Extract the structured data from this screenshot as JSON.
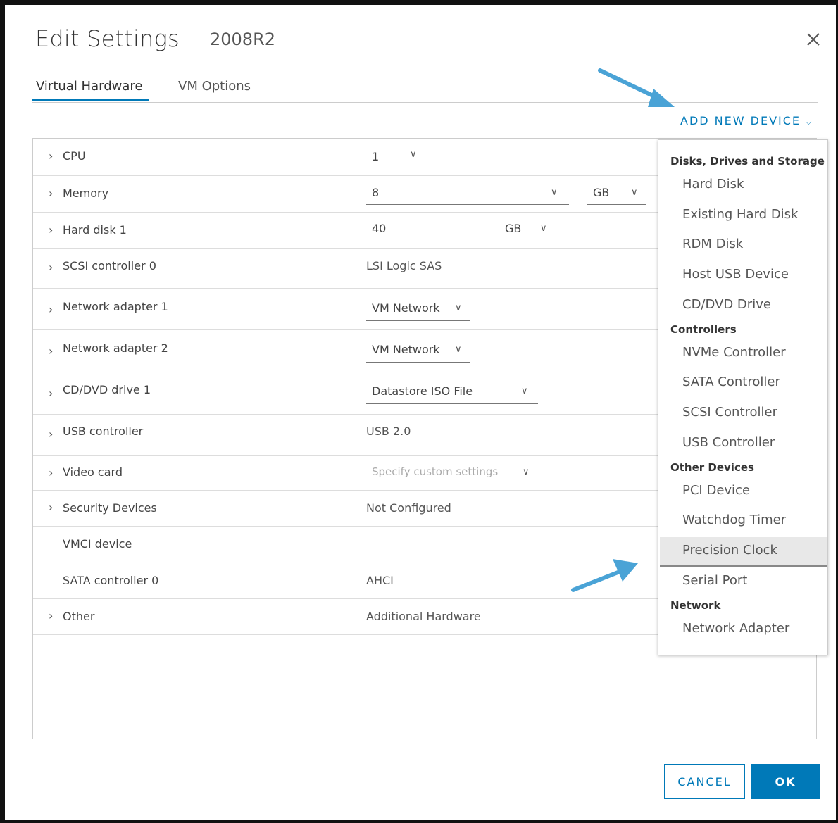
{
  "dialog": {
    "title": "Edit Settings",
    "vm_name": "2008R2"
  },
  "tabs": [
    {
      "label": "Virtual Hardware",
      "active": true
    },
    {
      "label": "VM Options",
      "active": false
    }
  ],
  "add_device_label": "ADD NEW DEVICE",
  "hardware": {
    "cpu": {
      "label": "CPU",
      "value": "1"
    },
    "memory": {
      "label": "Memory",
      "value": "8",
      "unit": "GB"
    },
    "hard_disk": {
      "label": "Hard disk 1",
      "value": "40",
      "unit": "GB"
    },
    "scsi": {
      "label": "SCSI controller 0",
      "value": "LSI Logic SAS"
    },
    "net1": {
      "label": "Network adapter 1",
      "value": "VM Network"
    },
    "net2": {
      "label": "Network adapter 2",
      "value": "VM Network"
    },
    "cddvd": {
      "label": "CD/DVD drive 1",
      "value": "Datastore ISO File"
    },
    "usb": {
      "label": "USB controller",
      "value": "USB 2.0"
    },
    "video": {
      "label": "Video card",
      "value": "Specify custom settings"
    },
    "security": {
      "label": "Security Devices",
      "value": "Not Configured"
    },
    "vmci": {
      "label": "VMCI device"
    },
    "sata": {
      "label": "SATA controller 0",
      "value": "AHCI"
    },
    "other": {
      "label": "Other",
      "value": "Additional Hardware"
    }
  },
  "menu": {
    "groups": [
      {
        "header": "Disks, Drives and Storage",
        "items": [
          "Hard Disk",
          "Existing Hard Disk",
          "RDM Disk",
          "Host USB Device",
          "CD/DVD Drive"
        ]
      },
      {
        "header": "Controllers",
        "items": [
          "NVMe Controller",
          "SATA Controller",
          "SCSI Controller",
          "USB Controller"
        ]
      },
      {
        "header": "Other Devices",
        "items": [
          "PCI Device",
          "Watchdog Timer",
          "Precision Clock",
          "Serial Port"
        ]
      },
      {
        "header": "Network",
        "items": [
          "Network Adapter"
        ]
      }
    ],
    "highlighted_item": "Precision Clock"
  },
  "buttons": {
    "cancel": "CANCEL",
    "ok": "OK"
  },
  "colors": {
    "accent": "#0079b8",
    "annotation_arrow": "#4aa3d6"
  },
  "icons": {
    "close": "close-icon",
    "row_expand": "chevron-right-icon",
    "dropdown": "chevron-down-icon"
  }
}
